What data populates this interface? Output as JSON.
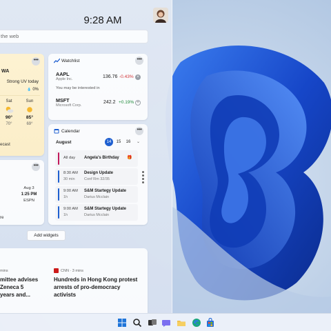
{
  "colors": {
    "accent": "#1e5fd0",
    "wallpaper": "#b9cde6",
    "positive": "#1f8a3a",
    "negative": "#d13438"
  },
  "panel": {
    "time": "9:28 AM",
    "search_placeholder": "the web",
    "add_widgets_label": "Add widgets"
  },
  "weather": {
    "location": "WA",
    "uv_text": "Strong UV today",
    "rain_text": "0%",
    "days": [
      {
        "label": "Sat",
        "icon": "partly-sunny-icon",
        "high": "90°",
        "low": "70°"
      },
      {
        "label": "Sun",
        "icon": "sunny-icon",
        "high": "85°",
        "low": "69°"
      }
    ],
    "footer_text": "ecast"
  },
  "watchlist": {
    "title": "Watchlist",
    "stocks": [
      {
        "symbol": "AAPL",
        "name": "Apple Inc.",
        "price": "136.76",
        "change": "-0.43%",
        "direction": "down"
      },
      {
        "symbol": "MSFT",
        "name": "Microsoft Corp.",
        "price": "242.2",
        "change": "+0.19%",
        "direction": "up"
      }
    ],
    "interest_text": "You may be interested in"
  },
  "calendar": {
    "title": "Calendar",
    "month": "August",
    "days": [
      "14",
      "15",
      "16"
    ],
    "selected_day": "14",
    "events": [
      {
        "time": "All day",
        "duration": "",
        "title": "Angela's Birthday",
        "subtitle": "",
        "color": "#c2185b"
      },
      {
        "time": "8:30 AM",
        "duration": "30 min",
        "title": "Design Update",
        "subtitle": "Conf Rm 32/35",
        "color": "#1e5fd0"
      },
      {
        "time": "9:00 AM",
        "duration": "1h",
        "title": "S&M Startegy Update",
        "subtitle": "Darius Mcclain",
        "color": "#1e5fd0"
      },
      {
        "time": "9:00 AM",
        "duration": "1h",
        "title": "S&M Startegy Update",
        "subtitle": "Darius Mcclain",
        "color": "#1e5fd0"
      }
    ]
  },
  "sports": {
    "date": "Aug 3",
    "time": "1:25 PM",
    "network": "ESPN",
    "more_text": "re"
  },
  "news": [
    {
      "source": "mins",
      "headline": "mittee advises Zeneca 5 years and..."
    },
    {
      "source": "CNN · 3 mins",
      "headline": "Hundreds in Hong Kong protest arrests of pro-democracy activists"
    }
  ],
  "taskbar": {
    "icons": [
      "windows-start-icon",
      "search-icon",
      "task-view-icon",
      "widgets-icon",
      "chat-icon",
      "file-explorer-icon",
      "edge-icon",
      "store-icon"
    ]
  }
}
